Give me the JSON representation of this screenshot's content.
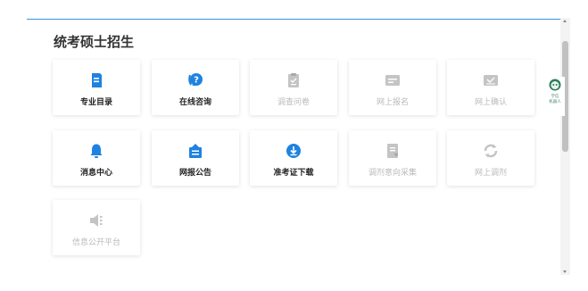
{
  "page": {
    "title": "统考硕士招生"
  },
  "colors": {
    "active": "#1f82e0",
    "disabled": "#c4c4c4",
    "accent_line": "#3a93e0"
  },
  "cards": [
    {
      "label": "专业目录",
      "icon": "book-list-icon",
      "active": true
    },
    {
      "label": "在线咨询",
      "icon": "question-bubble-icon",
      "active": true
    },
    {
      "label": "调查问卷",
      "icon": "clipboard-icon",
      "active": false
    },
    {
      "label": "网上报名",
      "icon": "form-card-icon",
      "active": false
    },
    {
      "label": "网上确认",
      "icon": "confirm-card-icon",
      "active": false
    },
    {
      "label": "消息中心",
      "icon": "bell-icon",
      "active": true
    },
    {
      "label": "网报公告",
      "icon": "bulletin-icon",
      "active": true
    },
    {
      "label": "准考证下载",
      "icon": "download-circle-icon",
      "active": true
    },
    {
      "label": "调剂意向采集",
      "icon": "doc-heart-icon",
      "active": false
    },
    {
      "label": "网上调剂",
      "icon": "refresh-arrows-icon",
      "active": false
    },
    {
      "label": "信息公开平台",
      "icon": "megaphone-icon",
      "active": false
    }
  ],
  "robot": {
    "line1": "学信",
    "line2": "机器人",
    "icon": "robot-icon"
  }
}
